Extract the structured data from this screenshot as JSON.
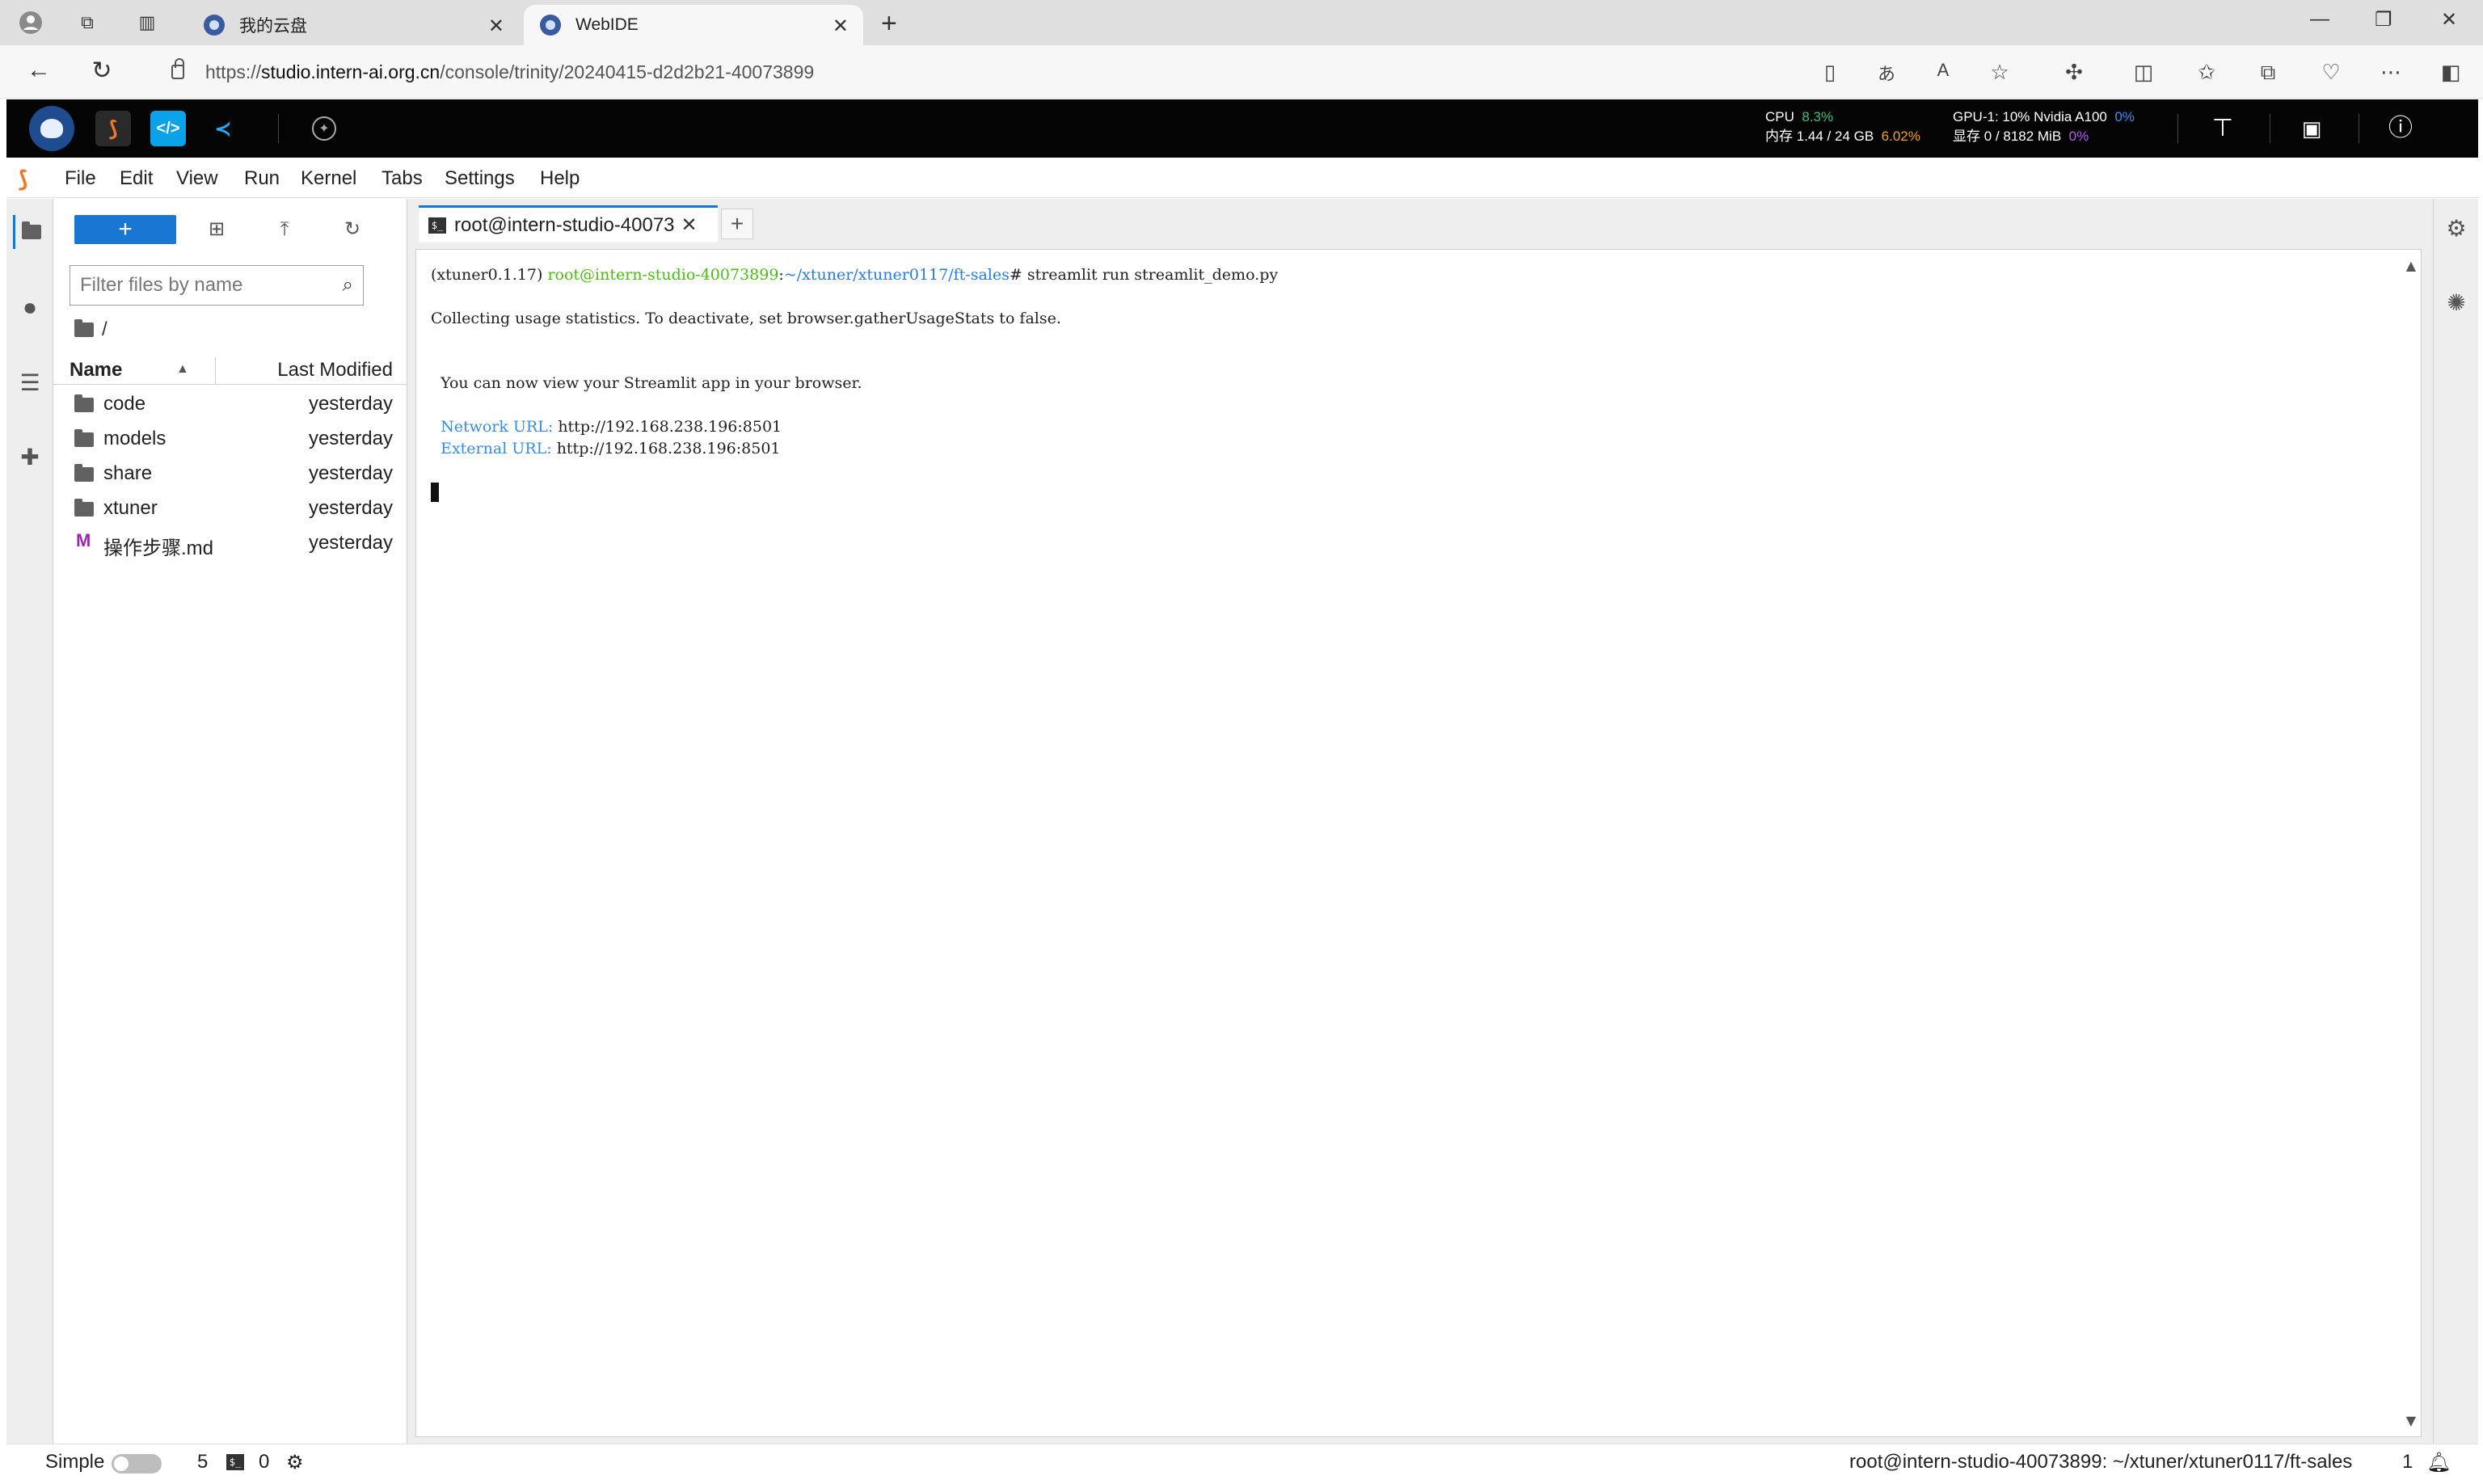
{
  "browser": {
    "tabs": [
      {
        "title": "我的云盘",
        "active": false
      },
      {
        "title": "WebIDE",
        "active": true
      }
    ],
    "url_domain": "studio.intern-ai.org.cn",
    "url_prefix": "https://",
    "url_path": "/console/trinity/20240415-d2d2b21-40073899"
  },
  "topbar": {
    "cpu_label": "CPU",
    "cpu_value": "8.3%",
    "mem_label": "内存",
    "mem_value": "1.44 / 24 GB",
    "mem_pct": "6.02%",
    "gpu_label": "GPU-1: 10% Nvidia A100",
    "gpu_pct": "0%",
    "vram_label": "显存",
    "vram_value": "0 / 8182 MiB",
    "vram_pct": "0%"
  },
  "menu": [
    "File",
    "Edit",
    "View",
    "Run",
    "Kernel",
    "Tabs",
    "Settings",
    "Help"
  ],
  "filebrowser": {
    "new_label": "+",
    "filter_placeholder": "Filter files by name",
    "path": "/",
    "col_name": "Name",
    "col_modified": "Last Modified",
    "files": [
      {
        "name": "code",
        "type": "folder",
        "modified": "yesterday"
      },
      {
        "name": "models",
        "type": "folder",
        "modified": "yesterday"
      },
      {
        "name": "share",
        "type": "folder",
        "modified": "yesterday"
      },
      {
        "name": "xtuner",
        "type": "folder",
        "modified": "yesterday"
      },
      {
        "name": "操作步骤.md",
        "type": "markdown",
        "modified": "yesterday"
      }
    ]
  },
  "terminal": {
    "tab_title": "root@intern-studio-40073",
    "env": "(xtuner0.1.17) ",
    "user_host": "root@intern-studio-40073899",
    "colon": ":",
    "cwd": "~/xtuner/xtuner0117/ft-sales",
    "command": "# streamlit run streamlit_demo.py",
    "line2": "Collecting usage statistics. To deactivate, set browser.gatherUsageStats to false.",
    "line3": "  You can now view your Streamlit app in your browser.",
    "net_label": "  Network URL: ",
    "net_url": "http://192.168.238.196:8501",
    "ext_label": "  External URL: ",
    "ext_url": "http://192.168.238.196:8501"
  },
  "status": {
    "mode": "Simple",
    "kernels": "5",
    "terminals": "0",
    "right_text": "root@intern-studio-40073899: ~/xtuner/xtuner0117/ft-sales",
    "notifications": "1"
  }
}
